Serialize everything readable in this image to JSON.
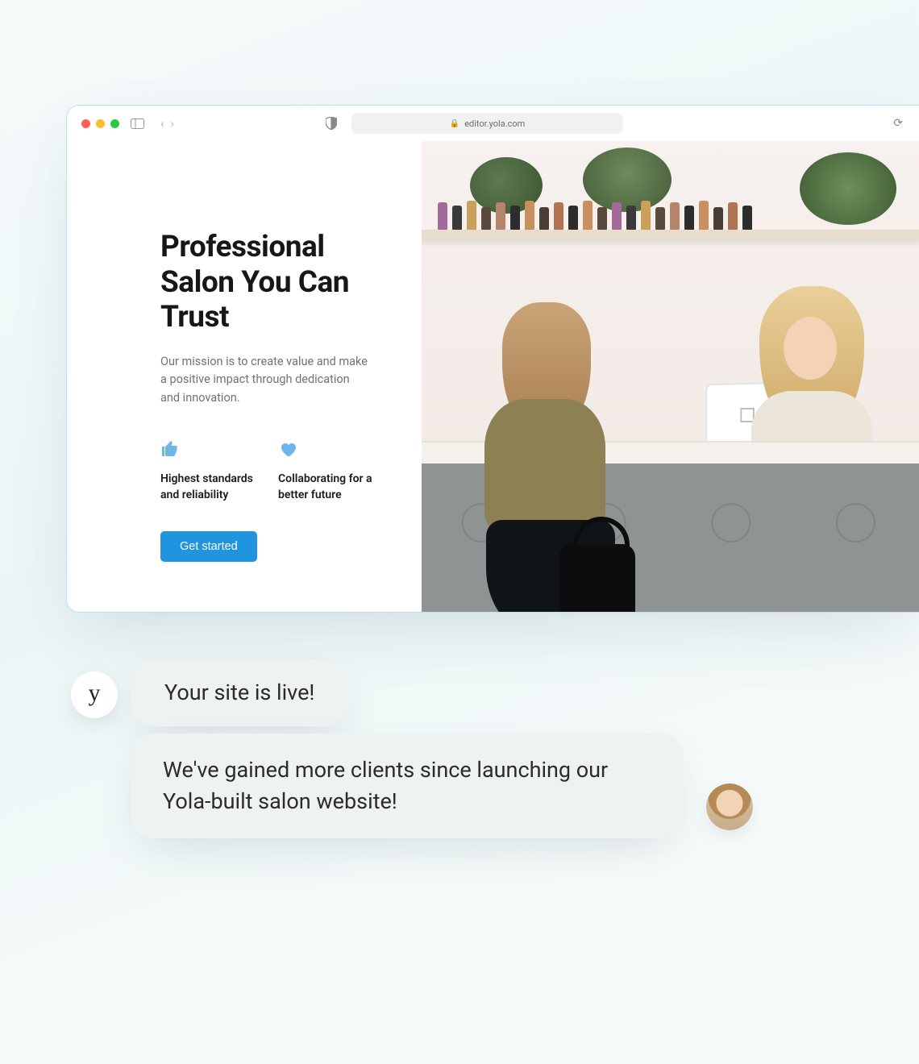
{
  "browser": {
    "url": "editor.yola.com"
  },
  "site": {
    "headline": "Professional Salon You Can Trust",
    "mission": "Our mission is to create value and make a positive impact through dedication and innovation.",
    "features": [
      {
        "label": "Highest standards and reliability"
      },
      {
        "label": "Collaborating for a better future"
      }
    ],
    "cta": "Get started"
  },
  "chat": {
    "brand_initial": "y",
    "bubble1": "Your site is live!",
    "bubble2": "We've gained more clients since launching our Yola-built salon website!"
  }
}
